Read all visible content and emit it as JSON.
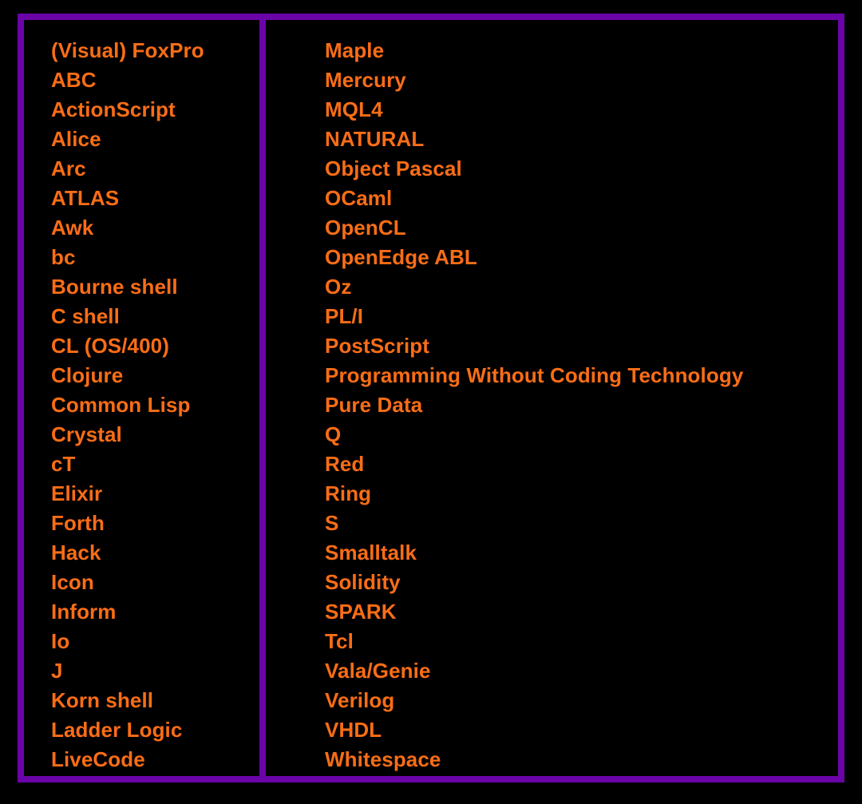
{
  "colors": {
    "background": "#000000",
    "border": "#6B04A8",
    "divider": "#6B04A8",
    "text": "#F96D16"
  },
  "table": {
    "columns": [
      {
        "name": "left-column",
        "items": [
          "(Visual) FoxPro",
          "ABC",
          "ActionScript",
          "Alice",
          "Arc",
          "ATLAS",
          "Awk",
          "bc",
          "Bourne shell",
          "C shell",
          "CL (OS/400)",
          "Clojure",
          "Common Lisp",
          "Crystal",
          "cT",
          "Elixir",
          "Forth",
          "Hack",
          "Icon",
          "Inform",
          "Io",
          "J",
          "Korn shell",
          "Ladder Logic",
          "LiveCode"
        ]
      },
      {
        "name": "right-column",
        "items": [
          "Maple",
          "Mercury",
          "MQL4",
          "NATURAL",
          "Object Pascal",
          "OCaml",
          "OpenCL",
          "OpenEdge ABL",
          "Oz",
          "PL/I",
          "PostScript",
          "Programming Without Coding Technology",
          "Pure Data",
          "Q",
          "Red",
          "Ring",
          "S",
          "Smalltalk",
          "Solidity",
          "SPARK",
          "Tcl",
          "Vala/Genie",
          "Verilog",
          "VHDL",
          "Whitespace"
        ]
      }
    ]
  }
}
